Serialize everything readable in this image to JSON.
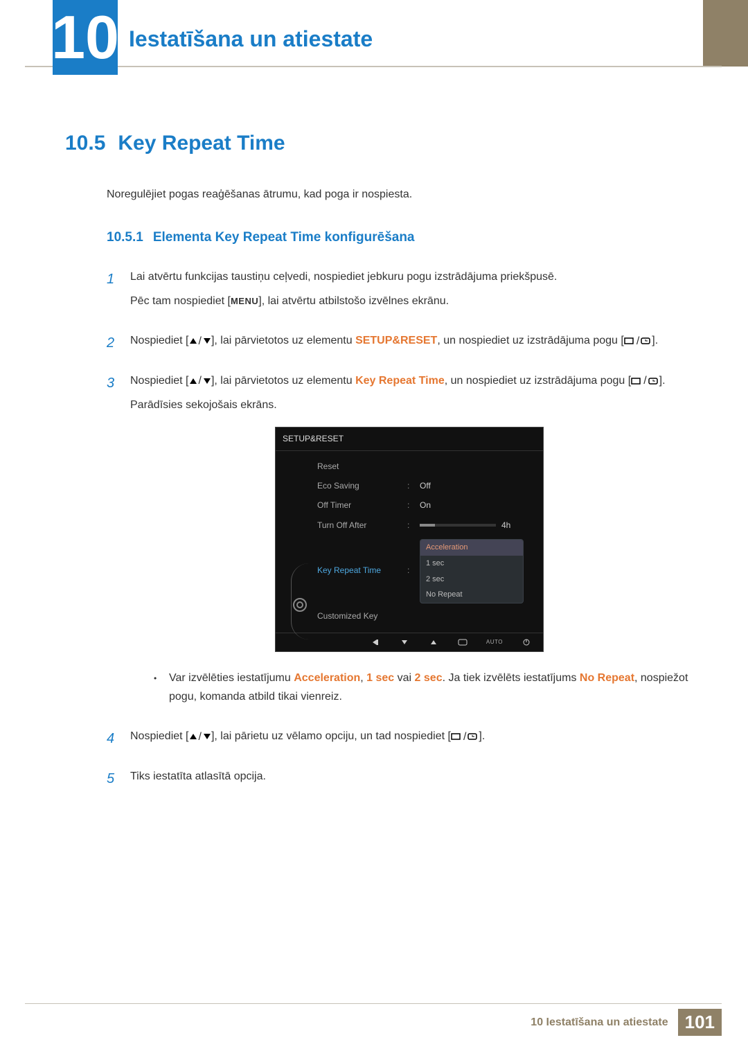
{
  "chapter": {
    "number": "10",
    "title": "Iestatīšana un atiestate"
  },
  "section": {
    "number": "10.5",
    "title": "Key Repeat Time",
    "intro": "Noregulējiet pogas reaģēšanas ātrumu, kad poga ir nospiesta."
  },
  "subsection": {
    "number": "10.5.1",
    "title": "Elementa Key Repeat Time konfigurēšana"
  },
  "steps": {
    "s1": {
      "num": "1",
      "p1": "Lai atvērtu funkcijas taustiņu ceļvedi, nospiediet jebkuru pogu izstrādājuma priekšpusē.",
      "p2a": "Pēc tam nospiediet [",
      "menu": "MENU",
      "p2b": "], lai atvērtu atbilstošo izvēlnes ekrānu."
    },
    "s2": {
      "num": "2",
      "a": "Nospiediet [",
      "b": "], lai pārvietotos uz elementu ",
      "hl": "SETUP&RESET",
      "c": ", un nospiediet uz izstrādājuma pogu [",
      "d": "]."
    },
    "s3": {
      "num": "3",
      "a": "Nospiediet [",
      "b": "], lai pārvietotos uz elementu ",
      "hl": "Key Repeat Time",
      "c": ", un nospiediet uz izstrādājuma pogu [",
      "d": "].",
      "after": "Parādīsies sekojošais ekrāns."
    },
    "bullet": {
      "a": "Var izvēlēties iestatījumu ",
      "hl1": "Acceleration",
      "sep1": ", ",
      "hl2": "1 sec",
      "mid": " vai ",
      "hl3": "2 sec",
      "b": ". Ja tiek izvēlēts iestatījums ",
      "hl4": "No Repeat",
      "c": ", nospiežot pogu, komanda atbild tikai vienreiz."
    },
    "s4": {
      "num": "4",
      "a": "Nospiediet [",
      "b": "], lai pārietu uz vēlamo opciju, un tad nospiediet [",
      "c": "]."
    },
    "s5": {
      "num": "5",
      "text": "Tiks iestatīta atlasītā opcija."
    }
  },
  "osd": {
    "title": "SETUP&RESET",
    "rows": {
      "reset": "Reset",
      "eco": "Eco Saving",
      "eco_val": "Off",
      "offtimer": "Off Timer",
      "offtimer_val": "On",
      "turnoff": "Turn Off After",
      "turnoff_val": "4h",
      "krt": "Key Repeat Time",
      "custom": "Customized Key"
    },
    "dropdown": {
      "o1": "Acceleration",
      "o2": "1 sec",
      "o3": "2 sec",
      "o4": "No Repeat"
    },
    "auto": "AUTO"
  },
  "footer": {
    "text": "10 Iestatīšana un atiestate",
    "page": "101"
  }
}
